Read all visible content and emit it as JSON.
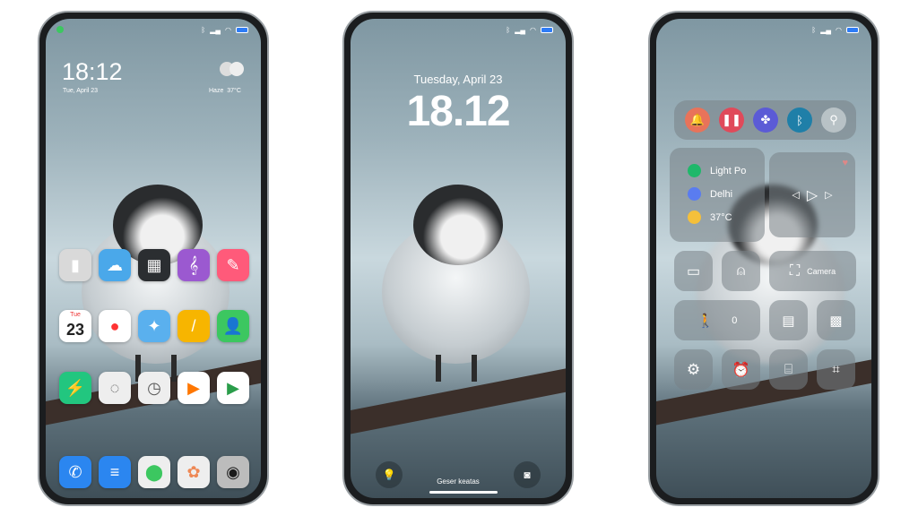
{
  "home": {
    "time": "18:12",
    "date": "Tue, April 23",
    "weather": "Haze",
    "temp": "37°C",
    "apps": [
      {
        "name": "calculator",
        "bg": "#d9d9d9",
        "glyph": "▮"
      },
      {
        "name": "weather",
        "bg": "#4aa8ea",
        "glyph": "☁"
      },
      {
        "name": "widgets",
        "bg": "#2b2e31",
        "glyph": "▦"
      },
      {
        "name": "music",
        "bg": "#9b59d0",
        "glyph": "𝄞"
      },
      {
        "name": "themes",
        "bg": "#ff5a7a",
        "glyph": "✎"
      },
      {
        "name": "calendar",
        "bg": "#ffffff",
        "glyph": "23"
      },
      {
        "name": "recorder",
        "bg": "#ffffff",
        "glyph": "●"
      },
      {
        "name": "browser",
        "bg": "#5ab0ee",
        "glyph": "✦"
      },
      {
        "name": "notes",
        "bg": "#f7b500",
        "glyph": "/"
      },
      {
        "name": "contacts",
        "bg": "#3cc760",
        "glyph": "👤"
      },
      {
        "name": "security",
        "bg": "#22c67f",
        "glyph": "⚡"
      },
      {
        "name": "compass",
        "bg": "#eeeeee",
        "glyph": "◌"
      },
      {
        "name": "clock",
        "bg": "#eeeeee",
        "glyph": "◷"
      },
      {
        "name": "video",
        "bg": "#ffffff",
        "glyph": "▶"
      },
      {
        "name": "play-store",
        "bg": "#ffffff",
        "glyph": "▶"
      }
    ],
    "calendar_day": "Tue",
    "dock": [
      {
        "name": "phone",
        "bg": "#2b86f0",
        "glyph": "✆"
      },
      {
        "name": "messages",
        "bg": "#2b86f0",
        "glyph": "≡"
      },
      {
        "name": "settings",
        "bg": "#eeeeee",
        "glyph": "⬤"
      },
      {
        "name": "gallery",
        "bg": "#eeeeee",
        "glyph": "✿"
      },
      {
        "name": "camera",
        "bg": "#bcbcbc",
        "glyph": "◉"
      }
    ]
  },
  "lock": {
    "date": "Tuesday, April 23",
    "time": "18.12",
    "swipe": "Geser keatas"
  },
  "control": {
    "toggles": [
      {
        "name": "notification",
        "bg": "#e8735a",
        "glyph": "🔔"
      },
      {
        "name": "mute",
        "bg": "#e04a5a",
        "glyph": "❚❚"
      },
      {
        "name": "theme",
        "bg": "#5b5bd6",
        "glyph": "✤"
      },
      {
        "name": "bluetooth",
        "bg": "#1f7fa8",
        "glyph": "ᛒ"
      },
      {
        "name": "location",
        "bg": "#b8c2c6",
        "glyph": "⚲"
      }
    ],
    "info": [
      {
        "label": "Light Po",
        "color": "#1fb86a"
      },
      {
        "label": "Delhi",
        "color": "#5a7cf0"
      },
      {
        "label": "37°C",
        "color": "#f5c03a"
      }
    ],
    "camera_label": "Camera",
    "steps": "0"
  }
}
